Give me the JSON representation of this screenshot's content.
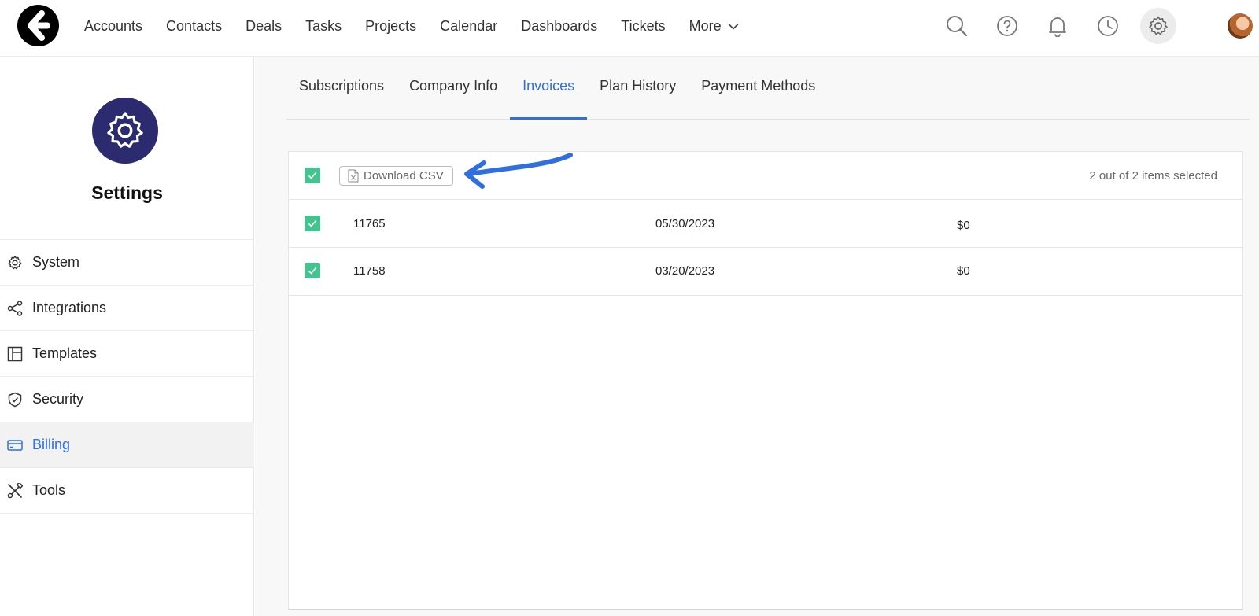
{
  "nav": {
    "items": [
      "Accounts",
      "Contacts",
      "Deals",
      "Tasks",
      "Projects",
      "Calendar",
      "Dashboards",
      "Tickets"
    ],
    "more_label": "More"
  },
  "sidebar": {
    "title": "Settings",
    "items": [
      {
        "label": "System",
        "icon": "gear-icon"
      },
      {
        "label": "Integrations",
        "icon": "share-icon"
      },
      {
        "label": "Templates",
        "icon": "layout-icon"
      },
      {
        "label": "Security",
        "icon": "shield-icon"
      },
      {
        "label": "Billing",
        "icon": "credit-card-icon"
      },
      {
        "label": "Tools",
        "icon": "tools-icon"
      }
    ],
    "active": "Billing"
  },
  "tabs": [
    "Subscriptions",
    "Company Info",
    "Invoices",
    "Plan History",
    "Payment Methods"
  ],
  "active_tab": "Invoices",
  "toolbar": {
    "download_label": "Download CSV",
    "selection_text": "2 out of 2 items selected"
  },
  "invoices": [
    {
      "id": "11765",
      "date": "05/30/2023",
      "amount": "$0",
      "checked": true
    },
    {
      "id": "11758",
      "date": "03/20/2023",
      "amount": "$0",
      "checked": true
    }
  ],
  "colors": {
    "accent": "#2f6fe0",
    "checkbox": "#45c38e",
    "settings_badge": "#2d2b70"
  }
}
